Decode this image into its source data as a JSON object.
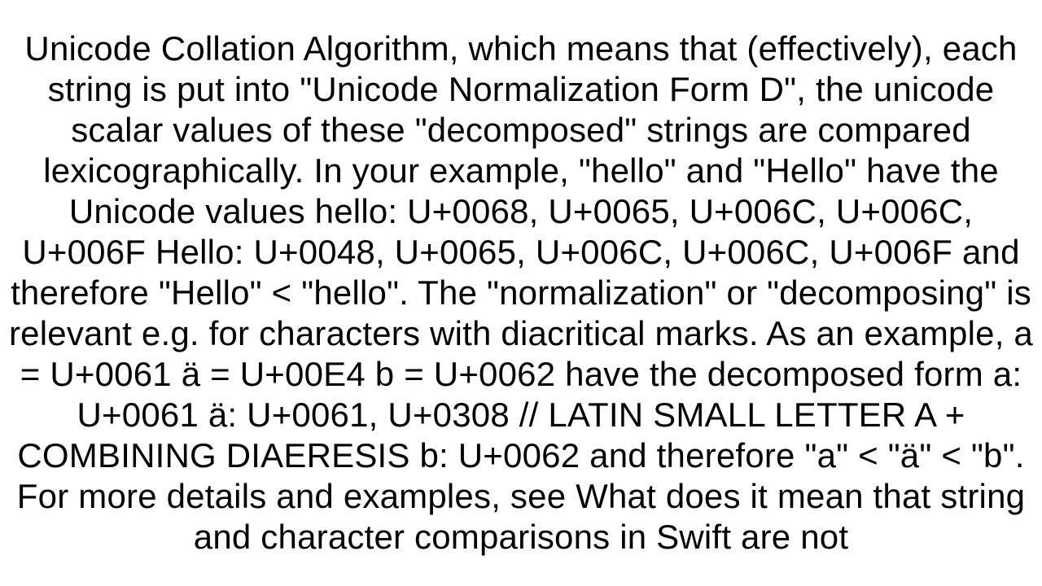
{
  "document": {
    "body_text": "Unicode Collation Algorithm, which means that (effectively), each string is put into \"Unicode Normalization Form D\", the unicode scalar values of these \"decomposed\" strings are compared lexicographically.  In your example, \"hello\" and \"Hello\" have the Unicode values hello: U+0068, U+0065, U+006C, U+006C, U+006F  Hello: U+0048, U+0065, U+006C, U+006C, U+006F   and therefore \"Hello\" < \"hello\". The \"normalization\" or \"decomposing\" is relevant e.g. for characters with diacritical marks. As an example,  a = U+0061 ä = U+00E4 b = U+0062  have the decomposed form a: U+0061 ä: U+0061, U+0308  // LATIN SMALL LETTER A + COMBINING DIAERESIS b: U+0062  and therefore \"a\" < \"ä\" < \"b\". For more details and examples, see What does it mean that string and character comparisons in Swift are not"
  }
}
